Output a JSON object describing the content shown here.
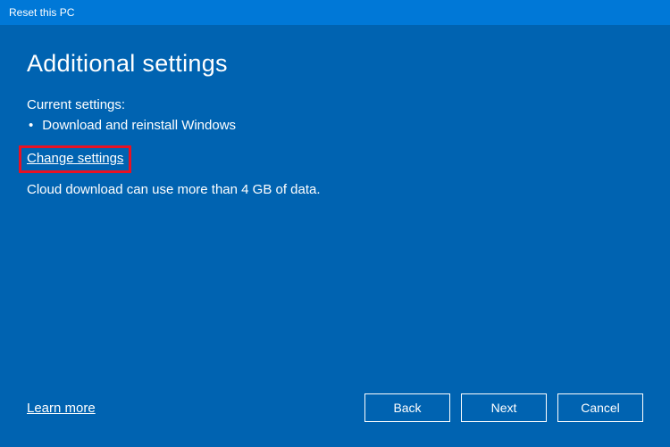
{
  "titlebar": {
    "title": "Reset this PC"
  },
  "main": {
    "heading": "Additional settings",
    "current_settings_label": "Current settings:",
    "settings_items": [
      "Download and reinstall Windows"
    ],
    "change_settings_link": "Change settings",
    "info_text": "Cloud download can use more than 4 GB of data."
  },
  "footer": {
    "learn_more_link": "Learn more",
    "back_label": "Back",
    "next_label": "Next",
    "cancel_label": "Cancel"
  }
}
